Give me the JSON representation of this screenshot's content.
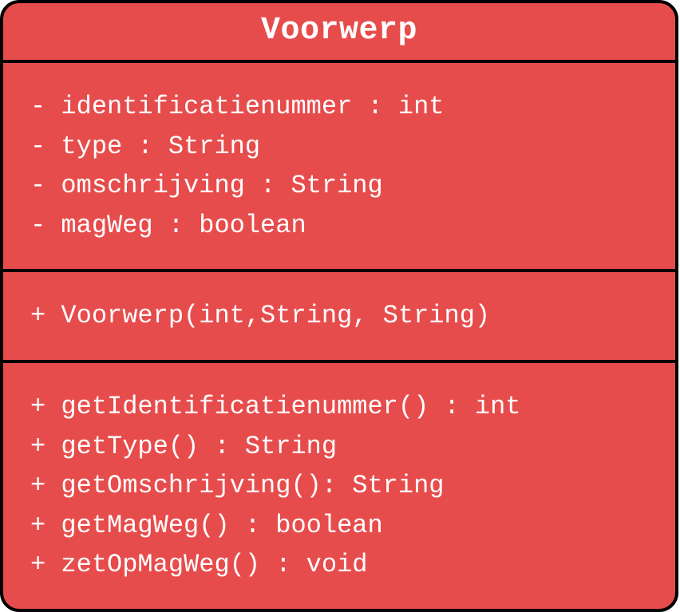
{
  "class": {
    "name": "Voorwerp",
    "attributes": [
      "- identificatienummer : int",
      "- type : String",
      "- omschrijving : String",
      "- magWeg : boolean"
    ],
    "constructors": [
      "+ Voorwerp(int,String, String)"
    ],
    "methods": [
      "+ getIdentificatienummer() : int",
      "+ getType() : String",
      "+ getOmschrijving(): String",
      "+ getMagWeg() : boolean",
      "+ zetOpMagWeg() : void"
    ]
  }
}
